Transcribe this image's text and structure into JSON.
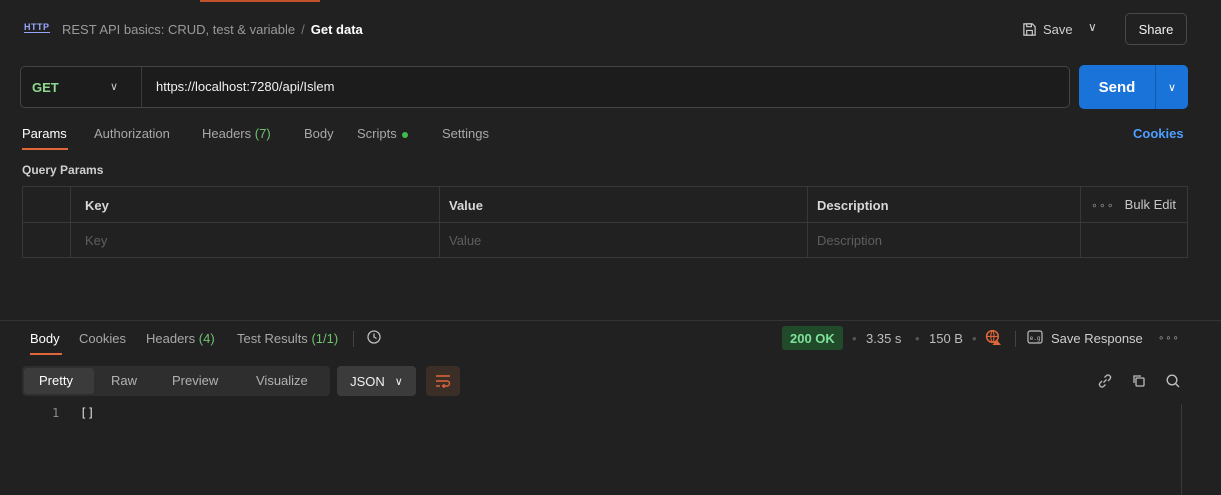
{
  "header": {
    "http_badge": "HTTP",
    "collection": "REST API basics: CRUD, test & variable",
    "separator": "/",
    "request_name": "Get data",
    "save_label": "Save",
    "share_label": "Share"
  },
  "request": {
    "method": "GET",
    "url": "https://localhost:7280/api/Islem",
    "send_label": "Send"
  },
  "request_tabs": [
    {
      "label": "Params"
    },
    {
      "label": "Authorization"
    },
    {
      "label": "Headers",
      "count": "(7)"
    },
    {
      "label": "Body"
    },
    {
      "label": "Scripts"
    },
    {
      "label": "Settings"
    }
  ],
  "cookies_label": "Cookies",
  "query_params": {
    "title": "Query Params",
    "headers": {
      "key": "Key",
      "value": "Value",
      "description": "Description"
    },
    "bulk_edit": "Bulk Edit",
    "placeholders": {
      "key": "Key",
      "value": "Value",
      "description": "Description"
    }
  },
  "response_tabs": [
    {
      "label": "Body"
    },
    {
      "label": "Cookies"
    },
    {
      "label": "Headers",
      "count": "(4)"
    },
    {
      "label": "Test Results",
      "count": "(1/1)"
    }
  ],
  "response_meta": {
    "status": "200 OK",
    "time": "3.35 s",
    "size": "150 B",
    "save_response": "Save Response"
  },
  "format_tabs": [
    "Pretty",
    "Raw",
    "Preview",
    "Visualize"
  ],
  "format_select": "JSON",
  "code": {
    "line_number": "1",
    "line_text": "[]"
  },
  "colors": {
    "background": "#212121",
    "accent_orange": "#e0673a",
    "send_blue": "#1a73d9",
    "status_green": "#7ee29a",
    "method_green": "#8fd88f",
    "link_blue": "#4d9fff"
  }
}
